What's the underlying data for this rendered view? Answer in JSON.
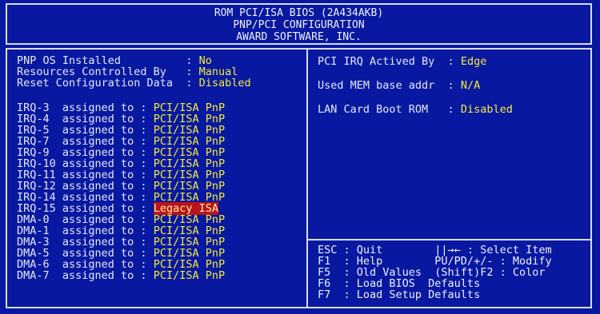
{
  "header": {
    "line1": "ROM PCI/ISA BIOS (2A434AKB)",
    "line2": "PNP/PCI CONFIGURATION",
    "line3": "AWARD SOFTWARE, INC."
  },
  "left": {
    "settings": [
      {
        "label": "PNP OS Installed          : ",
        "value": "No"
      },
      {
        "label": "Resources Controlled By   : ",
        "value": "Manual"
      },
      {
        "label": "Reset Configuration Data  : ",
        "value": "Disabled"
      }
    ],
    "assignments": [
      {
        "label": "IRQ-3  assigned to : ",
        "value": "PCI/ISA PnP"
      },
      {
        "label": "IRQ-4  assigned to : ",
        "value": "PCI/ISA PnP"
      },
      {
        "label": "IRQ-5  assigned to : ",
        "value": "PCI/ISA PnP"
      },
      {
        "label": "IRQ-7  assigned to : ",
        "value": "PCI/ISA PnP"
      },
      {
        "label": "IRQ-9  assigned to : ",
        "value": "PCI/ISA PnP"
      },
      {
        "label": "IRQ-10 assigned to : ",
        "value": "PCI/ISA PnP"
      },
      {
        "label": "IRQ-11 assigned to : ",
        "value": "PCI/ISA PnP"
      },
      {
        "label": "IRQ-12 assigned to : ",
        "value": "PCI/ISA PnP"
      },
      {
        "label": "IRQ-14 assigned to : ",
        "value": "PCI/ISA PnP"
      },
      {
        "label": "IRQ-15 assigned to : ",
        "value": "Legacy ISA"
      },
      {
        "label": "DMA-0  assigned to : ",
        "value": "PCI/ISA PnP"
      },
      {
        "label": "DMA-1  assigned to : ",
        "value": "PCI/ISA PnP"
      },
      {
        "label": "DMA-3  assigned to : ",
        "value": "PCI/ISA PnP"
      },
      {
        "label": "DMA-5  assigned to : ",
        "value": "PCI/ISA PnP"
      },
      {
        "label": "DMA-6  assigned to : ",
        "value": "PCI/ISA PnP"
      },
      {
        "label": "DMA-7  assigned to : ",
        "value": "PCI/ISA PnP"
      }
    ]
  },
  "right": {
    "settings": [
      {
        "label": "PCI IRQ Actived By  : ",
        "value": "Edge"
      },
      {
        "label": "Used MEM base addr  : ",
        "value": "N/A"
      },
      {
        "label": "LAN Card Boot ROM   : ",
        "value": "Disabled"
      }
    ]
  },
  "help": {
    "lines": [
      "ESC : Quit        ||→← : Select Item",
      "F1  : Help        PU/PD/+/- : Modify",
      "F5  : Old Values  (Shift)F2 : Color",
      "F6  : Load BIOS  Defaults",
      "F7  : Load Setup Defaults"
    ]
  },
  "colors": {
    "background": "#0818a0",
    "value": "#f2ea3a",
    "highlight_bg": "#b8141c",
    "text": "#e8ecf4"
  }
}
